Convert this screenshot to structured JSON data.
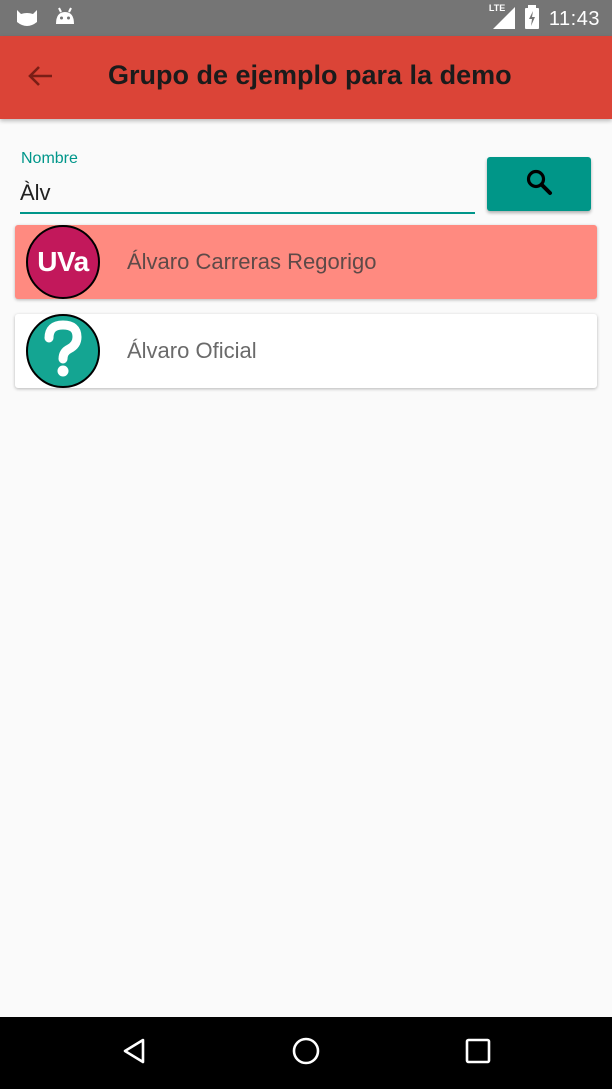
{
  "status_bar": {
    "time": "11:43",
    "network": "LTE",
    "icons": [
      "cat-icon",
      "android-icon",
      "signal-icon",
      "battery-charging-icon"
    ]
  },
  "app_bar": {
    "title": "Grupo de ejemplo para la demo",
    "back_icon": "arrow-back-icon",
    "background": "#db4437"
  },
  "search": {
    "label": "Nombre",
    "value": "Àlv",
    "accent": "#009688",
    "button_icon": "search-icon"
  },
  "results": [
    {
      "name": "Álvaro Carreras Regorigo",
      "avatar_text": "UVa",
      "avatar_color": "#c2185b",
      "highlighted": true,
      "card_color": "#ff8a80"
    },
    {
      "name": "Álvaro Oficial",
      "avatar_text": "?",
      "avatar_color": "#14a592",
      "highlighted": false,
      "card_color": "#ffffff"
    }
  ],
  "nav_bar": {
    "buttons": [
      "back-triangle-icon",
      "home-circle-icon",
      "recents-square-icon"
    ]
  }
}
